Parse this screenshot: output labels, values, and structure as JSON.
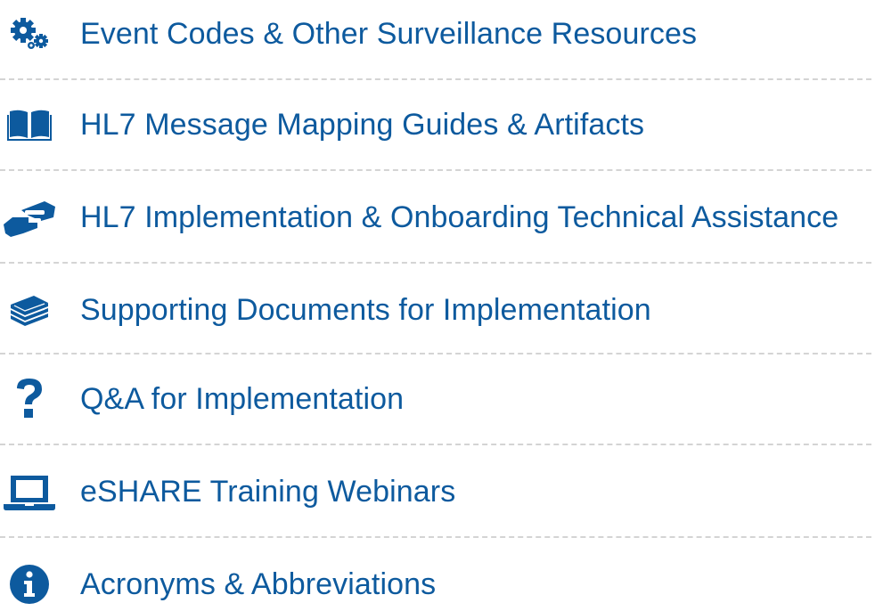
{
  "colors": {
    "link": "#0d5a9e",
    "icon": "#0d5a9e",
    "divider": "#d4d4d4"
  },
  "items": [
    {
      "label": "Event Codes & Other Surveillance Resources",
      "icon": "gears-icon"
    },
    {
      "label": "HL7 Message Mapping Guides & Artifacts",
      "icon": "book-open-icon"
    },
    {
      "label": "HL7 Implementation & Onboarding Technical Assistance",
      "icon": "handshake-icon"
    },
    {
      "label": "Supporting Documents for Implementation",
      "icon": "stacked-books-icon"
    },
    {
      "label": "Q&A for Implementation",
      "icon": "question-mark-icon"
    },
    {
      "label": "eSHARE Training Webinars",
      "icon": "laptop-icon"
    },
    {
      "label": "Acronyms & Abbreviations",
      "icon": "info-circle-icon"
    }
  ]
}
